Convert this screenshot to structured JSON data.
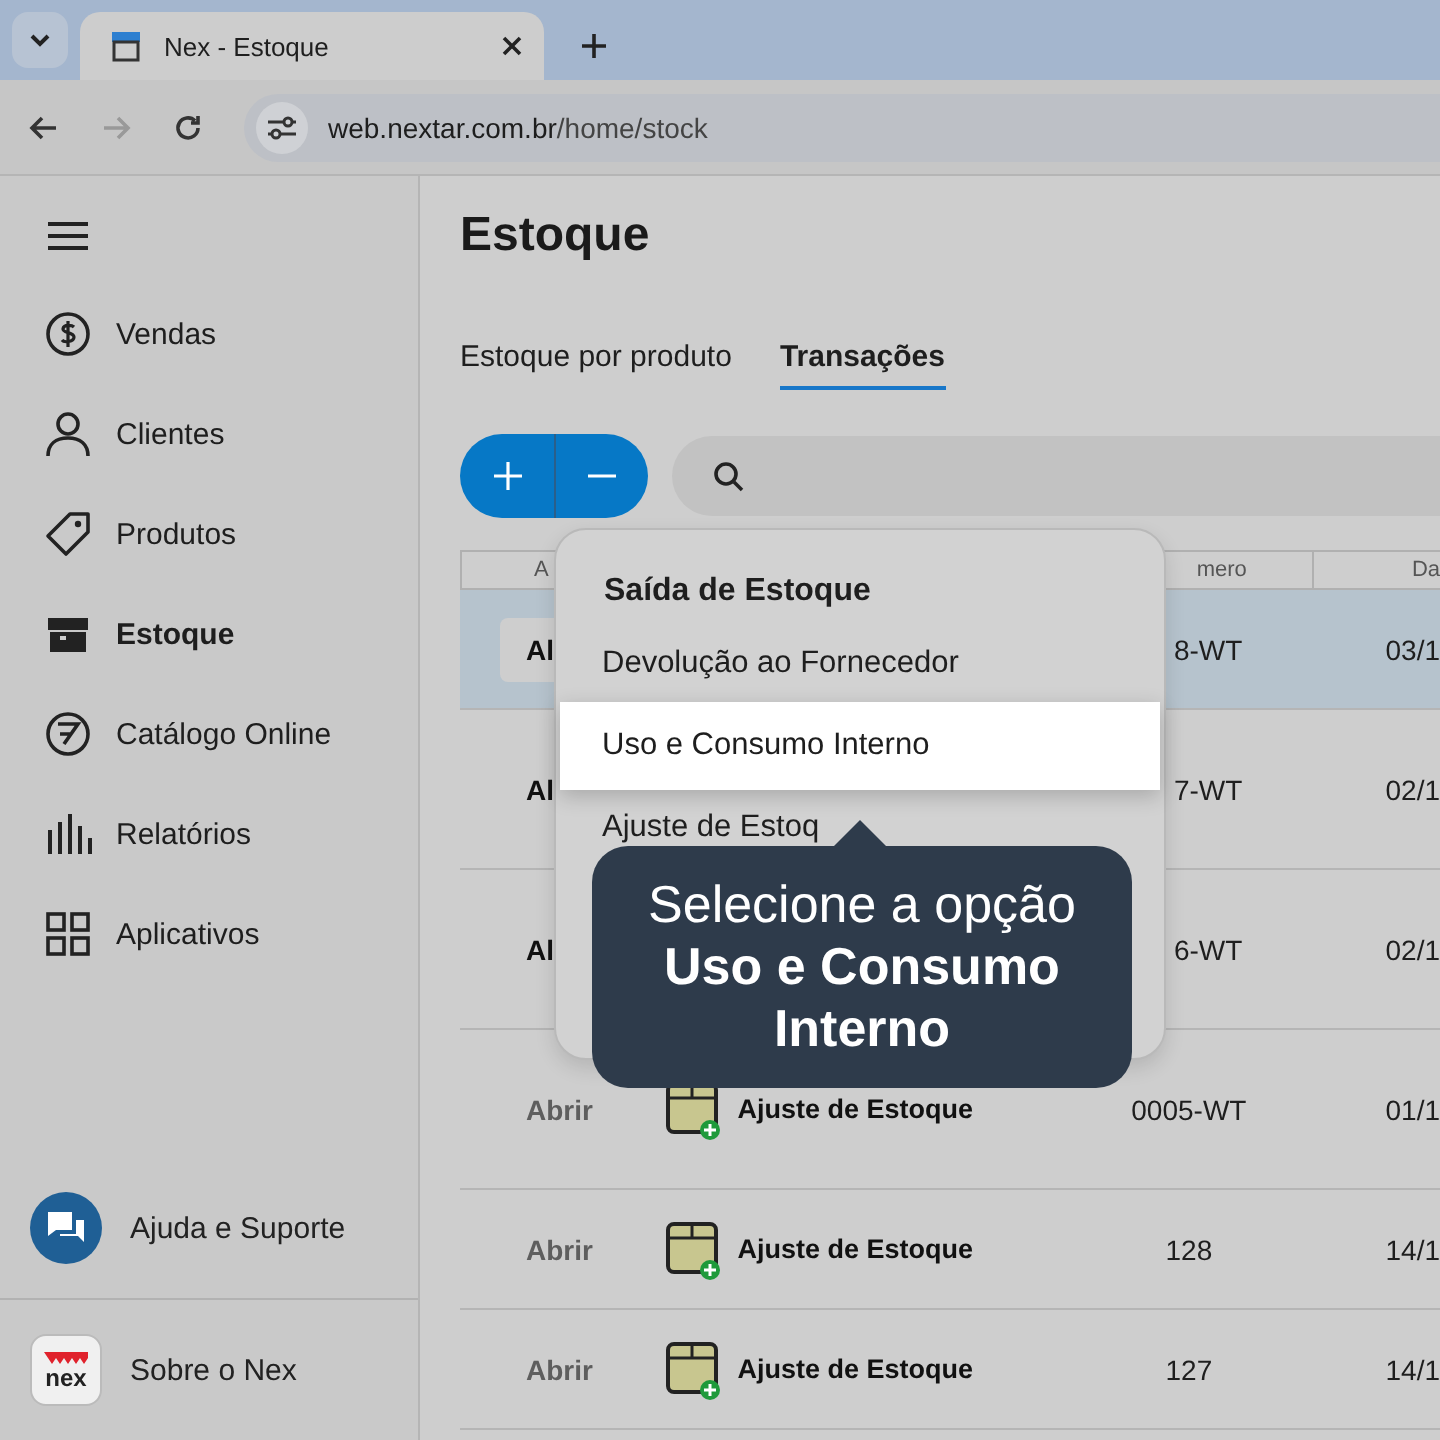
{
  "browser": {
    "tab_title": "Nex - Estoque",
    "url_host": "web.nextar.com.br",
    "url_path": "/home/stock"
  },
  "sidebar": {
    "items": [
      {
        "label": "Vendas",
        "selected": false
      },
      {
        "label": "Clientes",
        "selected": false
      },
      {
        "label": "Produtos",
        "selected": false
      },
      {
        "label": "Estoque",
        "selected": true
      },
      {
        "label": "Catálogo Online",
        "selected": false
      },
      {
        "label": "Relatórios",
        "selected": false
      },
      {
        "label": "Aplicativos",
        "selected": false
      }
    ],
    "help": "Ajuda e Suporte",
    "about": "Sobre o Nex",
    "logo": "nex"
  },
  "page": {
    "title": "Estoque",
    "tabs": [
      {
        "label": "Estoque por produto",
        "selected": false
      },
      {
        "label": "Transações",
        "selected": true
      }
    ]
  },
  "table": {
    "columns": [
      "A",
      "mero",
      "Da"
    ],
    "rows": [
      {
        "selected": true,
        "covered": true,
        "action": "Al",
        "type": "",
        "number": "8-WT",
        "date": "03/1"
      },
      {
        "selected": false,
        "covered": true,
        "action": "Al",
        "type": "",
        "number": "7-WT",
        "date": "02/1"
      },
      {
        "selected": false,
        "covered": true,
        "action": "Al",
        "type": "",
        "number": "6-WT",
        "date": "02/1"
      },
      {
        "selected": false,
        "covered": false,
        "action": "Abrir",
        "type": "Ajuste de Estoque",
        "number": "0005-WT",
        "date": "01/1"
      },
      {
        "selected": false,
        "covered": false,
        "action": "Abrir",
        "type": "Ajuste de Estoque",
        "number": "128",
        "date": "14/1"
      },
      {
        "selected": false,
        "covered": false,
        "action": "Abrir",
        "type": "Ajuste de Estoque",
        "number": "127",
        "date": "14/1"
      }
    ]
  },
  "menu": {
    "heading": "Saída de Estoque",
    "items": [
      {
        "label": "Devolução ao Fornecedor",
        "selected": false
      },
      {
        "label": "Uso e Consumo Interno",
        "selected": true
      },
      {
        "label": "Ajuste de Estoq",
        "selected": false
      }
    ]
  },
  "tooltip": "Selecione a opção **Uso e Consumo Interno**"
}
